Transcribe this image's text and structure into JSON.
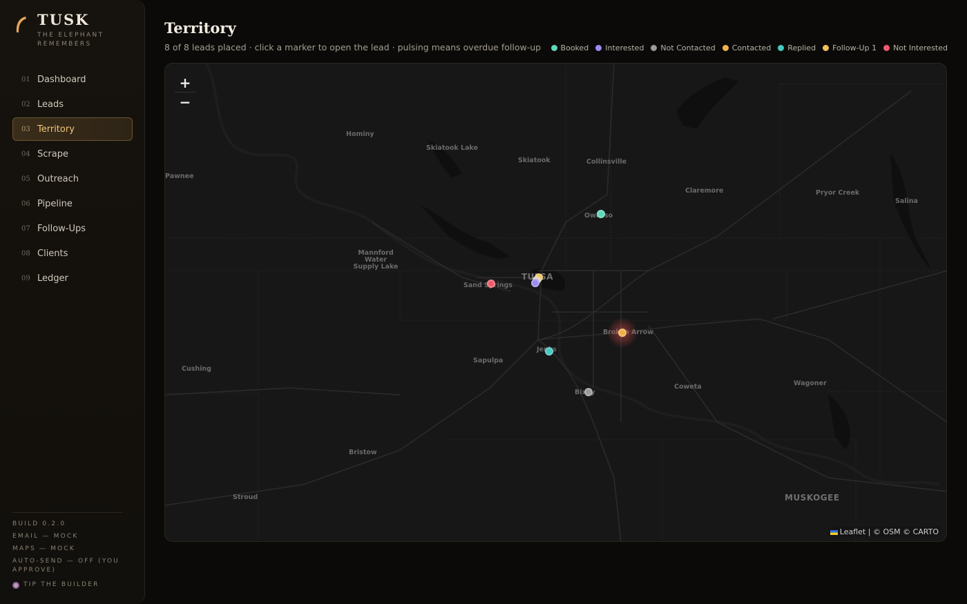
{
  "brand": {
    "name": "TUSK",
    "tagline": "THE ELEPHANT REMEMBERS"
  },
  "nav": [
    {
      "num": "01",
      "label": "Dashboard"
    },
    {
      "num": "02",
      "label": "Leads"
    },
    {
      "num": "03",
      "label": "Territory",
      "active": true
    },
    {
      "num": "04",
      "label": "Scrape"
    },
    {
      "num": "05",
      "label": "Outreach"
    },
    {
      "num": "06",
      "label": "Pipeline"
    },
    {
      "num": "07",
      "label": "Follow-Ups"
    },
    {
      "num": "08",
      "label": "Clients"
    },
    {
      "num": "09",
      "label": "Ledger"
    }
  ],
  "footer": {
    "build": "BUILD 0.2.0",
    "email": "EMAIL — MOCK",
    "maps": "MAPS — MOCK",
    "autosend": "AUTO-SEND — OFF (YOU APPROVE)",
    "tip": "TIP THE BUILDER"
  },
  "page": {
    "title": "Territory",
    "subtitle": "8 of 8 leads placed · click a marker to open the lead · pulsing means overdue follow-up"
  },
  "legend": [
    {
      "label": "Booked",
      "color": "#5fd6b8"
    },
    {
      "label": "Interested",
      "color": "#9b8cf0"
    },
    {
      "label": "Not Contacted",
      "color": "#9a9a9a"
    },
    {
      "label": "Contacted",
      "color": "#f0b14a"
    },
    {
      "label": "Replied",
      "color": "#45c9c0"
    },
    {
      "label": "Follow-Up 1",
      "color": "#f0c05a"
    },
    {
      "label": "Not Interested",
      "color": "#ef5b6b"
    }
  ],
  "map": {
    "zoom_in": "+",
    "zoom_out": "−",
    "places": [
      "Hominy",
      "Skiatook Lake",
      "Skiatook",
      "Collinsville",
      "Pawnee",
      "Claremore",
      "Pryor Creek",
      "Salina",
      "Owasso",
      "Mannford Water Supply Lake",
      "Sand Springs",
      "Tulsa",
      "Broken Arrow",
      "Jenks",
      "Sapulpa",
      "Cushing",
      "Bixby",
      "Coweta",
      "Wagoner",
      "Bristow",
      "Stroud",
      "MUSKOGEE"
    ],
    "markers": [
      {
        "status": "Booked",
        "color": "#5fd6b8"
      },
      {
        "status": "Not Interested",
        "color": "#ef5b6b"
      },
      {
        "status": "Interested",
        "color": "#9b8cf0"
      },
      {
        "status": "Follow-Up 1",
        "color": "#f0c05a"
      },
      {
        "status": "Not Contacted",
        "color": "#d9d0b8"
      },
      {
        "status": "Contacted",
        "color": "#f0b14a",
        "overdue": true
      },
      {
        "status": "Replied",
        "color": "#45c9c0"
      },
      {
        "status": "Not Contacted",
        "color": "#9a9a9a"
      }
    ],
    "attribution_leaflet": "Leaflet",
    "attribution_rest": "| © OSM © CARTO"
  }
}
